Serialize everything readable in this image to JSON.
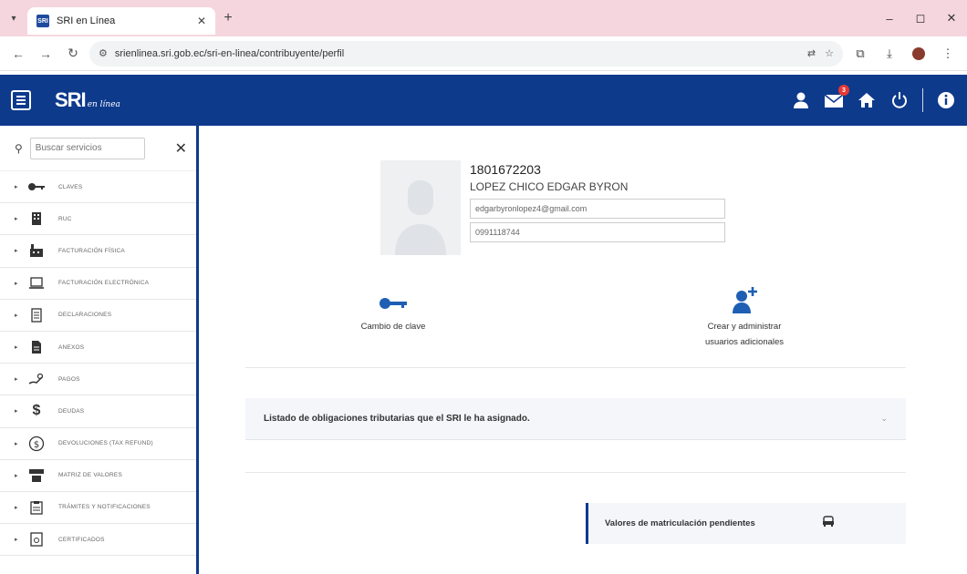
{
  "browser": {
    "tab_title": "SRI en Línea",
    "favicon_text": "SRI",
    "url": "srienlinea.sri.gob.ec/sri-en-linea/contribuyente/perfil"
  },
  "header": {
    "logo_main": "SRI",
    "logo_sub": "en línea",
    "notification_count": "3",
    "brand_color": "#0e3a8c"
  },
  "sidebar": {
    "search_placeholder": "Buscar servicios",
    "items": [
      {
        "label": "CLAVES",
        "icon": "key-icon"
      },
      {
        "label": "RUC",
        "icon": "building-icon"
      },
      {
        "label": "FACTURACIÓN FÍSICA",
        "icon": "factory-icon"
      },
      {
        "label": "FACTURACIÓN ELECTRÓNICA",
        "icon": "laptop-icon"
      },
      {
        "label": "DECLARACIONES",
        "icon": "document-icon"
      },
      {
        "label": "ANEXOS",
        "icon": "file-icon"
      },
      {
        "label": "PAGOS",
        "icon": "payment-icon"
      },
      {
        "label": "DEUDAS",
        "icon": "dollar-icon"
      },
      {
        "label": "DEVOLUCIONES (TAX REFUND)",
        "icon": "refund-icon"
      },
      {
        "label": "MATRIZ DE VALORES",
        "icon": "matrix-icon"
      },
      {
        "label": "TRÁMITES Y NOTIFICACIONES",
        "icon": "clipboard-icon"
      },
      {
        "label": "CERTIFICADOS",
        "icon": "certificate-icon"
      }
    ]
  },
  "profile": {
    "id": "1801672203",
    "name": "LOPEZ CHICO EDGAR BYRON",
    "email": "edgarbyronlopez4@gmail.com",
    "phone": "0991118744"
  },
  "actions": {
    "change_password": "Cambio de clave",
    "users_line1": "Crear y administrar",
    "users_line2": "usuarios adicionales"
  },
  "obligations": {
    "label": "Listado de obligaciones tributarias que el SRI le ha asignado."
  },
  "vehicles": {
    "label": "Valores de matriculación pendientes"
  }
}
